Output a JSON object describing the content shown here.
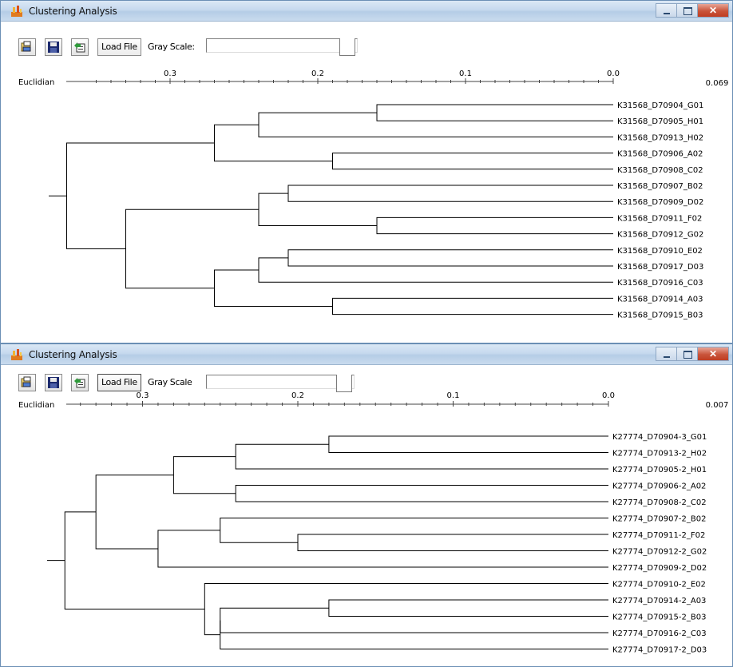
{
  "windows": [
    {
      "title": "Clustering Analysis",
      "toolbar": {
        "load_file_label": "Load File",
        "gray_scale_label": "Gray Scale:"
      },
      "scale": {
        "label": "Euclidian",
        "ticks": [
          "0.3",
          "0.2",
          "0.1",
          "0.0"
        ],
        "cutoff_value": "0.069"
      },
      "leaves": [
        "K31568_D70904_G01",
        "K31568_D70905_H01",
        "K31568_D70913_H02",
        "K31568_D70906_A02",
        "K31568_D70908_C02",
        "K31568_D70907_B02",
        "K31568_D70909_D02",
        "K31568_D70911_F02",
        "K31568_D70912_G02",
        "K31568_D70910_E02",
        "K31568_D70917_D03",
        "K31568_D70916_C03",
        "K31568_D70914_A03",
        "K31568_D70915_B03"
      ]
    },
    {
      "title": "Clustering Analysis",
      "toolbar": {
        "load_file_label": "Load File",
        "gray_scale_label": "Gray Scale"
      },
      "scale": {
        "label": "Euclidian",
        "ticks": [
          "0.3",
          "0.2",
          "0.1",
          "0.0"
        ],
        "cutoff_value": "0.007"
      },
      "leaves": [
        "K27774_D70904-3_G01",
        "K27774_D70913-2_H02",
        "K27774_D70905-2_H01",
        "K27774_D70906-2_A02",
        "K27774_D70908-2_C02",
        "K27774_D70907-2_B02",
        "K27774_D70911-2_F02",
        "K27774_D70912-2_G02",
        "K27774_D70909-2_D02",
        "K27774_D70910-2_E02",
        "K27774_D70914-2_A03",
        "K27774_D70915-2_B03",
        "K27774_D70916-2_C03",
        "K27774_D70917-2_D03"
      ]
    }
  ],
  "chart_data": [
    {
      "type": "dendrogram",
      "metric": "Euclidian",
      "axis_ticks": [
        0.3,
        0.2,
        0.1,
        0.0
      ],
      "leaves": [
        "K31568_D70904_G01",
        "K31568_D70905_H01",
        "K31568_D70913_H02",
        "K31568_D70906_A02",
        "K31568_D70908_C02",
        "K31568_D70907_B02",
        "K31568_D70909_D02",
        "K31568_D70911_F02",
        "K31568_D70912_G02",
        "K31568_D70910_E02",
        "K31568_D70917_D03",
        "K31568_D70916_C03",
        "K31568_D70914_A03",
        "K31568_D70915_B03"
      ],
      "merges": [
        {
          "a": [
            0
          ],
          "b": [
            1
          ],
          "height": 0.16
        },
        {
          "a": [
            0,
            1
          ],
          "b": [
            2
          ],
          "height": 0.24
        },
        {
          "a": [
            3
          ],
          "b": [
            4
          ],
          "height": 0.19
        },
        {
          "a": [
            0,
            1,
            2
          ],
          "b": [
            3,
            4
          ],
          "height": 0.27
        },
        {
          "a": [
            5
          ],
          "b": [
            6
          ],
          "height": 0.22
        },
        {
          "a": [
            7
          ],
          "b": [
            8
          ],
          "height": 0.16
        },
        {
          "a": [
            5,
            6
          ],
          "b": [
            7,
            8
          ],
          "height": 0.24
        },
        {
          "a": [
            9
          ],
          "b": [
            10
          ],
          "height": 0.22
        },
        {
          "a": [
            9,
            10
          ],
          "b": [
            11
          ],
          "height": 0.24
        },
        {
          "a": [
            12
          ],
          "b": [
            13
          ],
          "height": 0.19
        },
        {
          "a": [
            9,
            10,
            11
          ],
          "b": [
            12,
            13
          ],
          "height": 0.27
        },
        {
          "a": [
            5,
            6,
            7,
            8
          ],
          "b": [
            9,
            10,
            11,
            12,
            13
          ],
          "height": 0.33
        },
        {
          "a": [
            0,
            1,
            2,
            3,
            4
          ],
          "b": [
            5,
            6,
            7,
            8,
            9,
            10,
            11,
            12,
            13
          ],
          "height": 0.37
        }
      ],
      "cutoff": 0.069
    },
    {
      "type": "dendrogram",
      "metric": "Euclidian",
      "axis_ticks": [
        0.3,
        0.2,
        0.1,
        0.0
      ],
      "leaves": [
        "K27774_D70904-3_G01",
        "K27774_D70913-2_H02",
        "K27774_D70905-2_H01",
        "K27774_D70906-2_A02",
        "K27774_D70908-2_C02",
        "K27774_D70907-2_B02",
        "K27774_D70911-2_F02",
        "K27774_D70912-2_G02",
        "K27774_D70909-2_D02",
        "K27774_D70910-2_E02",
        "K27774_D70914-2_A03",
        "K27774_D70915-2_B03",
        "K27774_D70916-2_C03",
        "K27774_D70917-2_D03"
      ],
      "merges": [
        {
          "a": [
            0
          ],
          "b": [
            1
          ],
          "height": 0.18
        },
        {
          "a": [
            0,
            1
          ],
          "b": [
            2
          ],
          "height": 0.24
        },
        {
          "a": [
            3
          ],
          "b": [
            4
          ],
          "height": 0.24
        },
        {
          "a": [
            0,
            1,
            2
          ],
          "b": [
            3,
            4
          ],
          "height": 0.28
        },
        {
          "a": [
            6
          ],
          "b": [
            7
          ],
          "height": 0.2
        },
        {
          "a": [
            5
          ],
          "b": [
            6,
            7
          ],
          "height": 0.25
        },
        {
          "a": [
            5,
            6,
            7
          ],
          "b": [
            8
          ],
          "height": 0.29
        },
        {
          "a": [
            0,
            1,
            2,
            3,
            4
          ],
          "b": [
            5,
            6,
            7,
            8
          ],
          "height": 0.33
        },
        {
          "a": [
            10
          ],
          "b": [
            11
          ],
          "height": 0.18
        },
        {
          "a": [
            10,
            11
          ],
          "b": [
            12
          ],
          "height": 0.25
        },
        {
          "a": [
            10,
            11,
            12
          ],
          "b": [
            13
          ],
          "height": 0.25
        },
        {
          "a": [
            9
          ],
          "b": [
            10,
            11,
            12,
            13
          ],
          "height": 0.26
        },
        {
          "a": [
            0,
            1,
            2,
            3,
            4,
            5,
            6,
            7,
            8
          ],
          "b": [
            9,
            10,
            11,
            12,
            13
          ],
          "height": 0.35
        }
      ],
      "cutoff": 0.007
    }
  ]
}
